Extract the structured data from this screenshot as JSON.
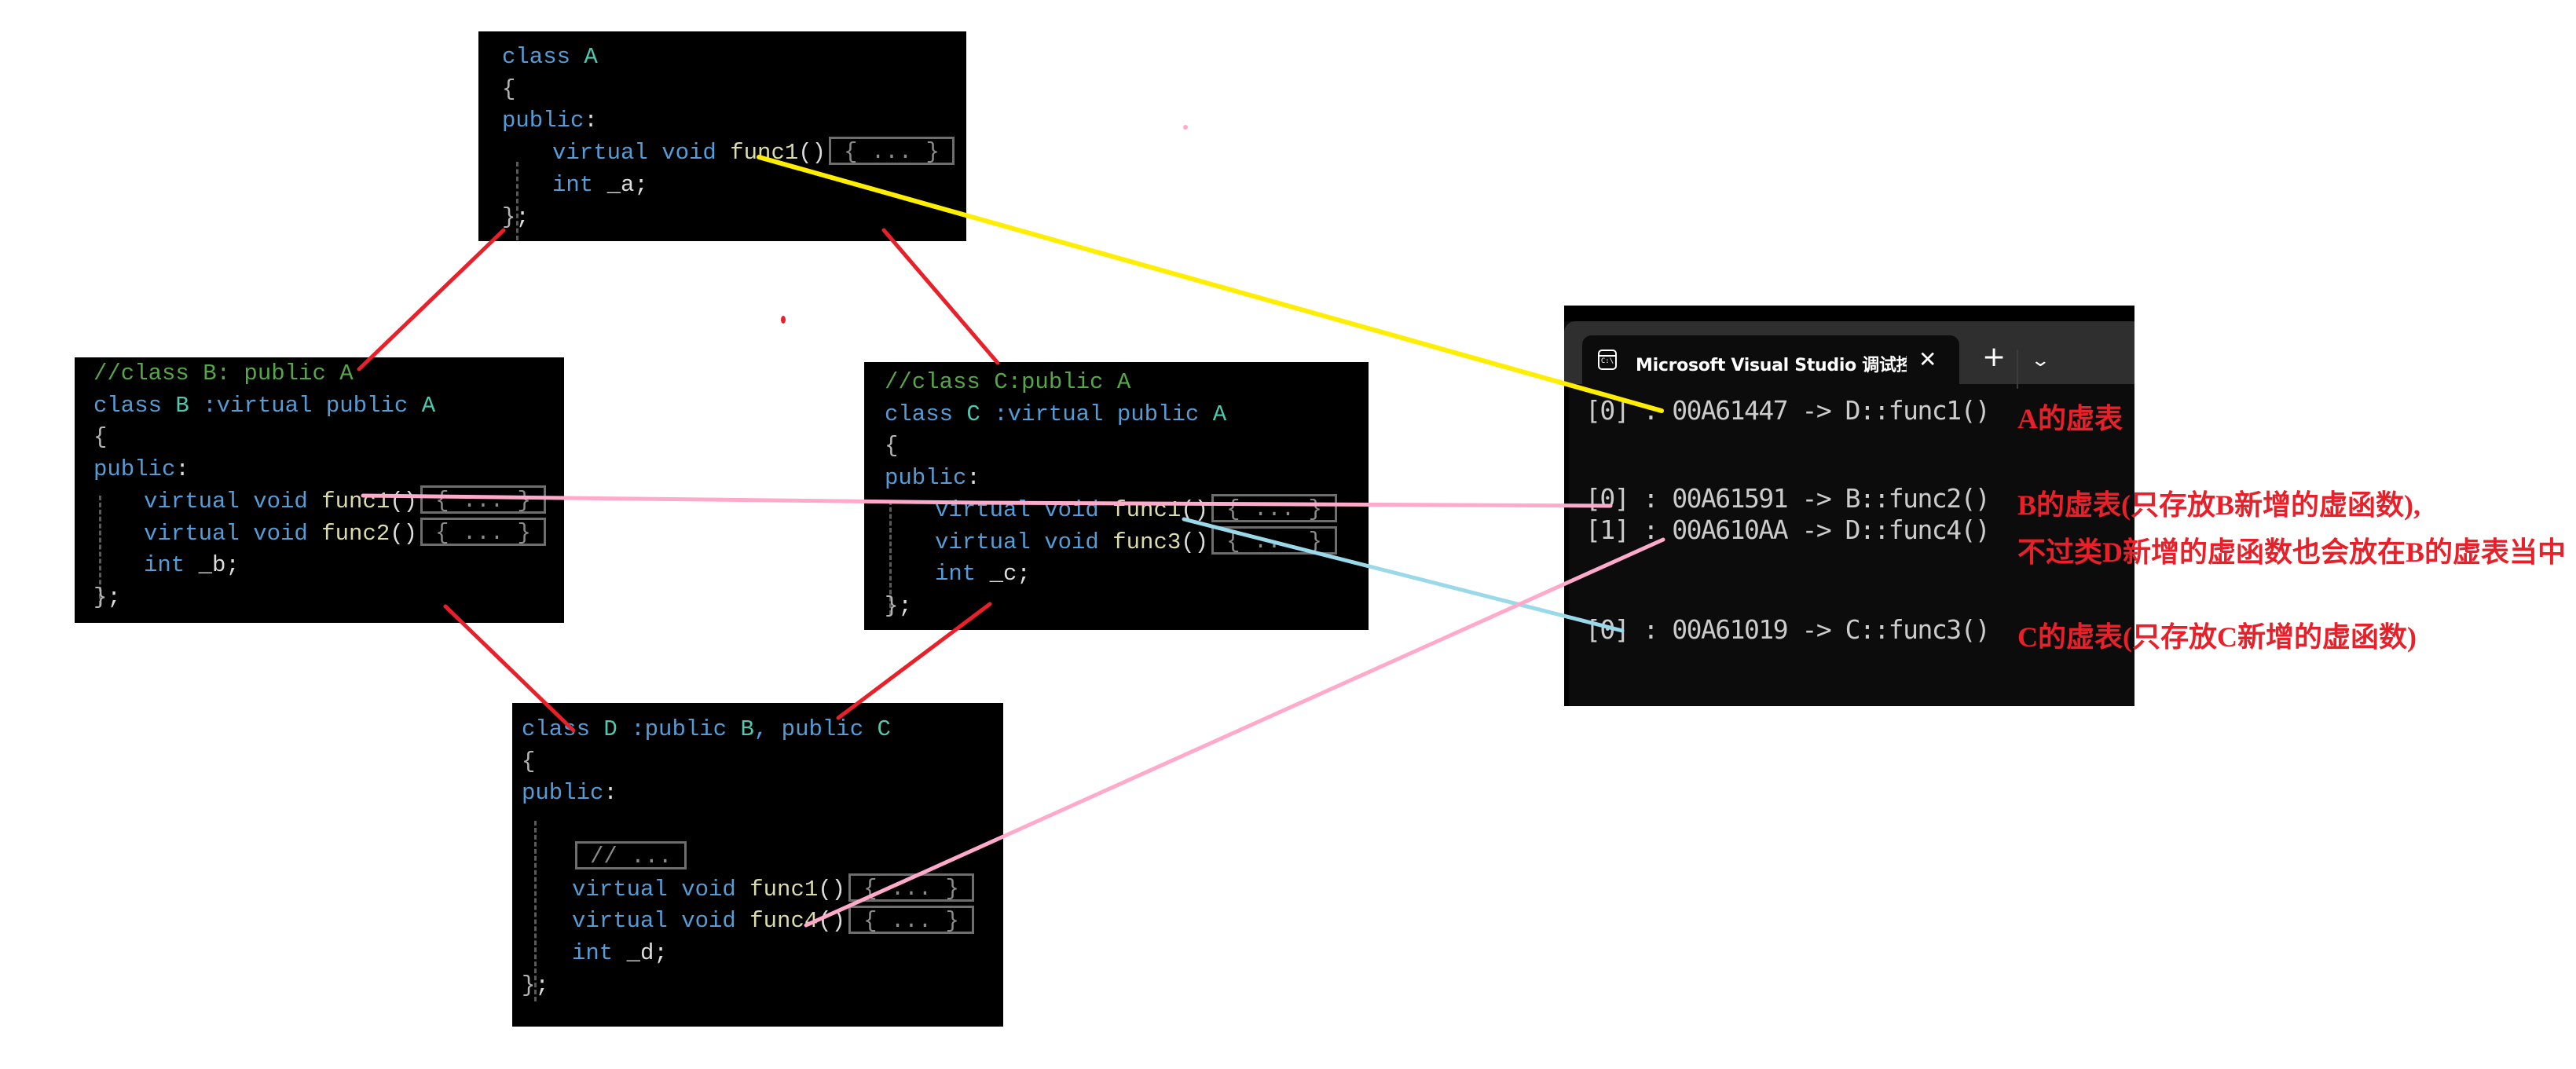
{
  "code_boxes": {
    "class_a": {
      "lines": [
        {
          "kw": "class ",
          "cls": "A"
        },
        {
          "br": "{"
        },
        {
          "kw": "public",
          "pl": ":"
        },
        {
          "kw": "virtual void ",
          "fn": "func1",
          "pl": "()",
          "collapsed": "{ ... }"
        },
        {
          "kw": "int ",
          "pl": "_a;"
        },
        {
          "br": "}",
          "pl": ";"
        }
      ]
    },
    "class_b": {
      "lines": [
        {
          "cm": "//class B: public A"
        },
        {
          "kw": "class ",
          "cls": "B",
          "kw2": " :virtual public ",
          "cls2": "A"
        },
        {
          "br": "{"
        },
        {
          "kw": "public",
          "pl": ":"
        },
        {
          "kw": "virtual void ",
          "fn": "func1",
          "pl": "()",
          "collapsed": "{ ... }"
        },
        {
          "kw": "virtual void ",
          "fn": "func2",
          "pl": "()",
          "collapsed": "{ ... }"
        },
        {
          "kw": "int ",
          "pl": "_b;"
        },
        {
          "br": "}",
          "pl": ";"
        }
      ]
    },
    "class_c": {
      "lines": [
        {
          "cm": "//class C:public A"
        },
        {
          "kw": "class ",
          "cls": "C",
          "kw2": " :virtual public ",
          "cls2": "A"
        },
        {
          "br": "{"
        },
        {
          "kw": "public",
          "pl": ":"
        },
        {
          "kw": "virtual void ",
          "fn": "func1",
          "pl": "()",
          "collapsed": "{ ... }"
        },
        {
          "kw": "virtual void ",
          "fn": "func3",
          "pl": "()",
          "collapsed": "{ ... }"
        },
        {
          "kw": "int ",
          "pl": "_c;"
        },
        {
          "br": "}",
          "pl": ";"
        }
      ]
    },
    "class_d": {
      "lines": [
        {
          "kw": "class ",
          "cls": "D",
          "kw2": " :public ",
          "cls2": "B",
          "kw3": ", public ",
          "cls3": "C"
        },
        {
          "br": "{"
        },
        {
          "kw": "public",
          "pl": ":"
        },
        {},
        {
          "collapsed": "// ..."
        },
        {
          "kw": "virtual void ",
          "fn": "func1",
          "pl": "()",
          "collapsed": "{ ... }"
        },
        {
          "kw": "virtual void ",
          "fn": "func4",
          "pl": "()",
          "collapsed": "{ ... }"
        },
        {
          "kw": "int ",
          "pl": "_d;"
        },
        {
          "br": "}",
          "pl": ";"
        }
      ]
    }
  },
  "terminal": {
    "tab_title": "Microsoft Visual Studio 调试控制台",
    "tab_icon": "console-icon",
    "close_glyph": "✕",
    "new_tab_glyph": "+",
    "dropdown_glyph": "⌄",
    "lines": [
      "[0] : 00A61447 -> D::func1()",
      "[0] : 00A61591 -> B::func2()",
      "[1] : 00A610AA -> D::func4()",
      "[0] : 00A61019 -> C::func3()"
    ]
  },
  "annotations": {
    "a_vtable": "A的虚表",
    "b_vtable_1": "B的虚表(只存放B新增的虚函数),",
    "b_vtable_2": "不过类D新增的虚函数也会放在B的虚表当中",
    "c_vtable": "C的虚表(只存放C新增的虚函数)"
  },
  "colors": {
    "inheritance_line": "#e8202a",
    "a_func1_link": "#ffee00",
    "b_link": "#ffaacb",
    "c_link": "#99d9ea",
    "annotation_text": "#e8202a"
  }
}
